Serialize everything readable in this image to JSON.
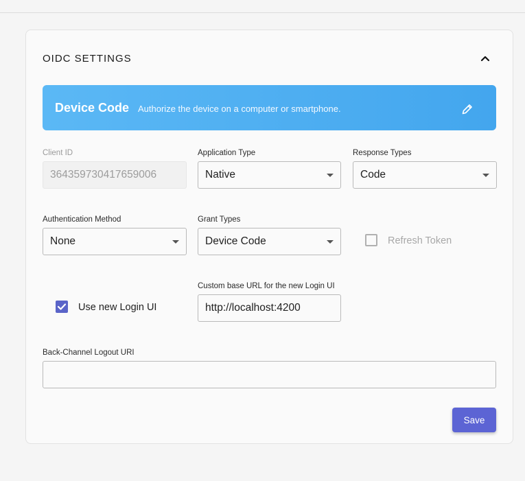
{
  "section": {
    "title": "OIDC SETTINGS"
  },
  "banner": {
    "title": "Device Code",
    "description": "Authorize the device on a computer or smartphone."
  },
  "fields": {
    "client_id": {
      "label": "Client ID",
      "value": "364359730417659006"
    },
    "application_type": {
      "label": "Application Type",
      "value": "Native"
    },
    "response_types": {
      "label": "Response Types",
      "value": "Code"
    },
    "authentication_method": {
      "label": "Authentication Method",
      "value": "None"
    },
    "grant_types": {
      "label": "Grant Types",
      "value": "Device Code"
    },
    "refresh_token": {
      "label": "Refresh Token",
      "checked": false
    },
    "use_new_login_ui": {
      "label": "Use new Login UI",
      "checked": true
    },
    "custom_base_url": {
      "label": "Custom base URL for the new Login UI",
      "value": "http://localhost:4200"
    },
    "back_channel_logout_uri": {
      "label": "Back-Channel Logout URI",
      "value": ""
    }
  },
  "actions": {
    "save_label": "Save"
  },
  "icons": {
    "collapse": "chevron-up-icon",
    "edit": "pencil-icon",
    "check": "check-icon"
  },
  "colors": {
    "banner_start": "#5bb8f5",
    "banner_end": "#43a6ee",
    "primary": "#5c64d4",
    "checkbox": "#5a64c8"
  }
}
